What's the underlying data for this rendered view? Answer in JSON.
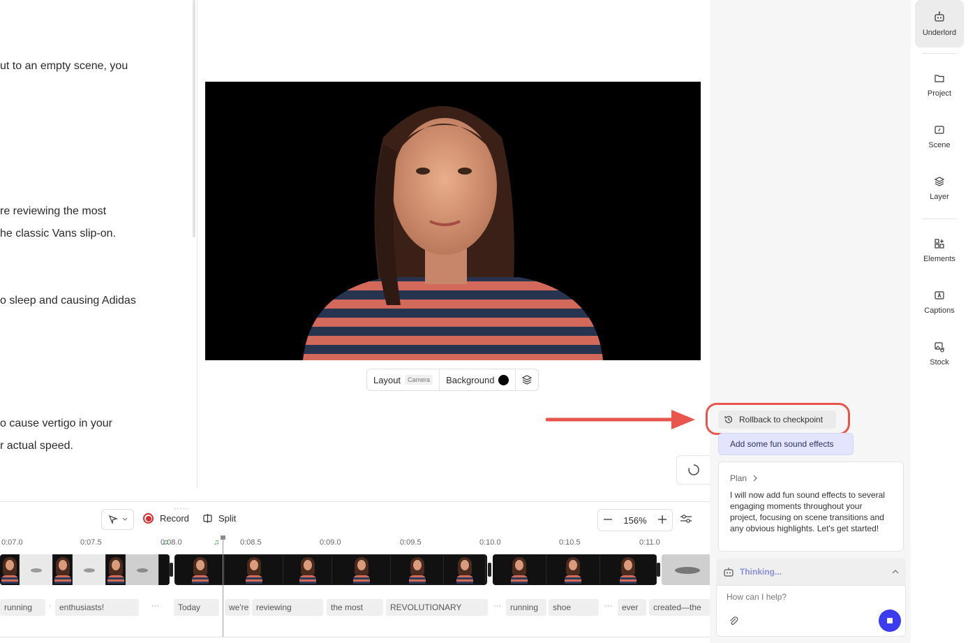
{
  "transcript": {
    "lines": [
      "ut to an empty scene, you",
      "re reviewing the most",
      "he classic Vans slip-on.",
      "o sleep and causing Adidas",
      "o cause vertigo in your",
      "r actual speed."
    ]
  },
  "stage": {
    "layout_label": "Layout",
    "layout_value": "Camera",
    "background_label": "Background",
    "background_color": "#000000"
  },
  "timeline": {
    "record_label": "Record",
    "split_label": "Split",
    "zoom_value": "156%",
    "ruler": [
      "0:07.0",
      "0:07.5",
      "0:08.0",
      "0:08.5",
      "0:09.0",
      "0:09.5",
      "0:10.0",
      "0:10.5",
      "0:11.0"
    ],
    "words": [
      "running",
      "enthusiasts!",
      "Today",
      "we're",
      "reviewing",
      "the most",
      "REVOLUTIONARY",
      "running",
      "shoe",
      "ever",
      "created—the"
    ],
    "ellipsis": "···",
    "dot": "·"
  },
  "chat": {
    "rollback_label": "Rollback to checkpoint",
    "user_message": "Add some fun sound effects",
    "plan_label": "Plan",
    "plan_text": "I will now add fun sound effects to several engaging moments throughout your project, focusing on scene transitions and any obvious highlights. Let's get started!",
    "thinking_label": "Thinking...",
    "input_placeholder": "How can I help?"
  },
  "rail": {
    "items": [
      {
        "label": "Underlord",
        "icon": "robot-icon"
      },
      {
        "label": "Project",
        "icon": "folder-icon"
      },
      {
        "label": "Scene",
        "icon": "scene-icon"
      },
      {
        "label": "Layer",
        "icon": "layers-icon"
      },
      {
        "label": "Elements",
        "icon": "elements-icon"
      },
      {
        "label": "Captions",
        "icon": "captions-icon"
      },
      {
        "label": "Stock",
        "icon": "stock-icon"
      }
    ]
  },
  "colors": {
    "accent": "#3b3cf0",
    "highlight_ring": "#e8554c",
    "record": "#d42f2f",
    "user_bubble": "#e3e4fd"
  }
}
